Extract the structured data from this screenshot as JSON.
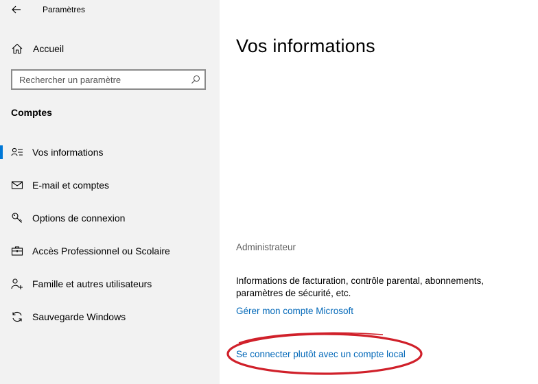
{
  "window": {
    "app_title": "Paramètres"
  },
  "sidebar": {
    "home_label": "Accueil",
    "search": {
      "placeholder": "Rechercher un paramètre",
      "value": ""
    },
    "section_title": "Comptes",
    "items": [
      {
        "label": "Vos informations",
        "icon": "person-list-icon",
        "selected": true
      },
      {
        "label": "E-mail et comptes",
        "icon": "mail-icon",
        "selected": false
      },
      {
        "label": "Options de connexion",
        "icon": "key-icon",
        "selected": false
      },
      {
        "label": "Accès Professionnel ou Scolaire",
        "icon": "briefcase-icon",
        "selected": false
      },
      {
        "label": "Famille et autres utilisateurs",
        "icon": "person-add-icon",
        "selected": false
      },
      {
        "label": "Sauvegarde Windows",
        "icon": "sync-icon",
        "selected": false
      }
    ]
  },
  "main": {
    "page_title": "Vos informations",
    "account_type": "Administrateur",
    "info_text": "Informations de facturation, contrôle parental, abonnements, paramètres de sécurité, etc.",
    "manage_link": "Gérer mon compte Microsoft",
    "local_account_link": "Se connecter plutôt avec un compte local"
  },
  "colors": {
    "sidebar_bg": "#f2f2f2",
    "accent": "#0078d7",
    "link": "#0067b8",
    "annotation": "#d0202a"
  }
}
